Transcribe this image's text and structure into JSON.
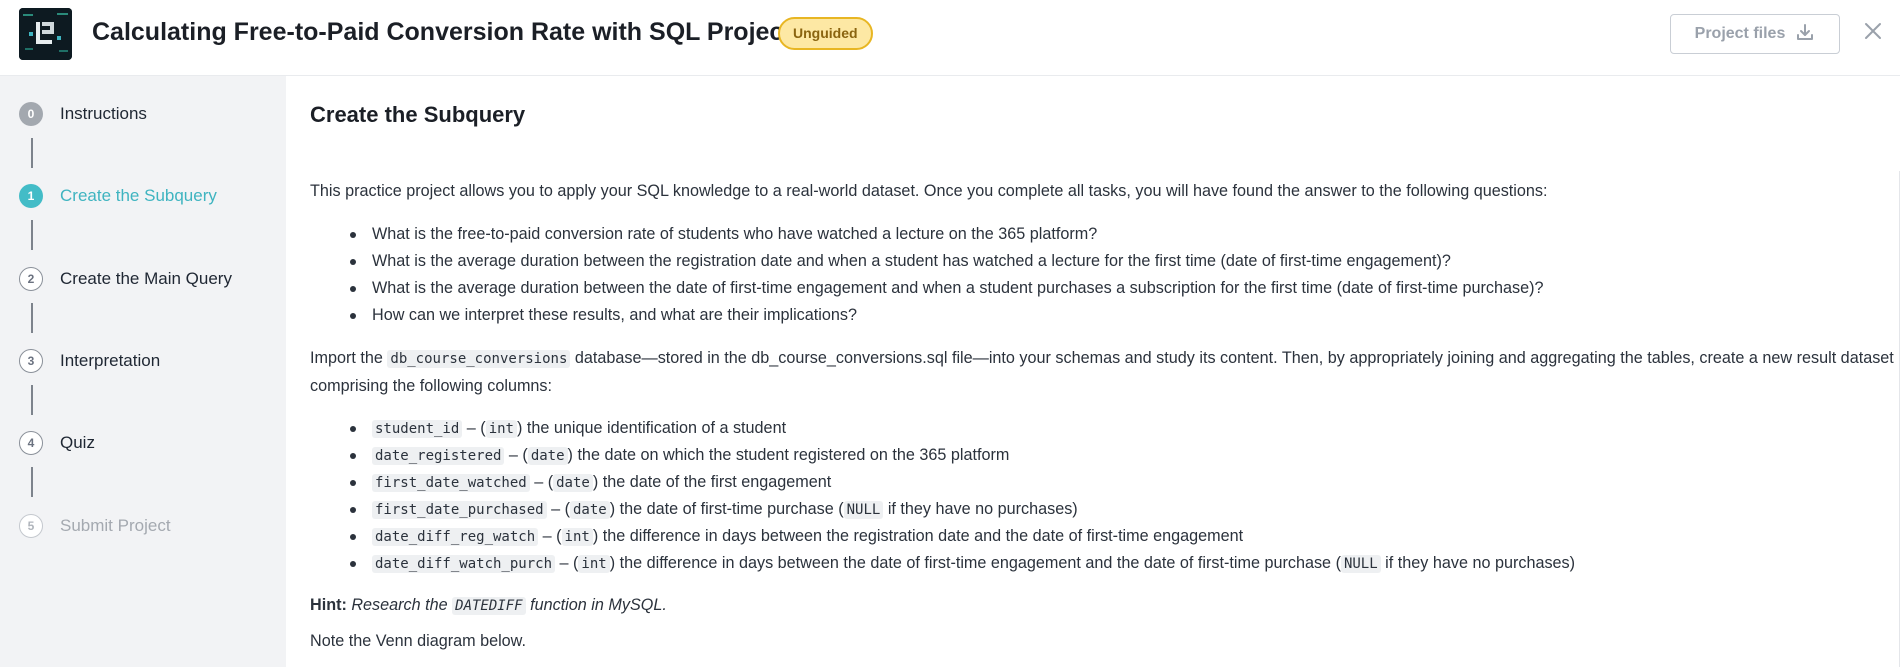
{
  "header": {
    "title": "Calculating Free-to-Paid Conversion Rate with SQL Project",
    "badge": "Unguided",
    "project_files_label": "Project files"
  },
  "sidebar": {
    "steps": [
      {
        "num": "0",
        "label": "Instructions",
        "state": "done"
      },
      {
        "num": "1",
        "label": "Create the Subquery",
        "state": "active"
      },
      {
        "num": "2",
        "label": "Create the Main Query",
        "state": "todo"
      },
      {
        "num": "3",
        "label": "Interpretation",
        "state": "todo"
      },
      {
        "num": "4",
        "label": "Quiz",
        "state": "todo"
      },
      {
        "num": "5",
        "label": "Submit Project",
        "state": "disabled"
      }
    ]
  },
  "main": {
    "section_title": "Create the Subquery",
    "intro": "This practice project allows you to apply your SQL knowledge to a real-world dataset. Once you complete all tasks, you will have found the answer to the following questions:",
    "questions": [
      "What is the free-to-paid conversion rate of students who have watched a lecture on the 365 platform?",
      "What is the average duration between the registration date and when a student has watched a lecture for the first time (date of first-time engagement)?",
      "What is the average duration between the date of first-time engagement and when a student purchases a subscription for the first time (date of first-time purchase)?",
      "How can we interpret these results, and what are their implications?"
    ],
    "import": {
      "prefix": "Import the",
      "db_code": "db_course_conversions",
      "text": "database—stored in the db_course_conversions.sql file—into your schemas and study its content. Then, by appropriately joining and aggregating the tables, create a new result dataset comprising the following columns:"
    },
    "columns": [
      {
        "name": "student_id",
        "type": "int",
        "desc": "the unique identification of a student",
        "null_note_pre": "",
        "null_code": "",
        "null_note_post": ""
      },
      {
        "name": "date_registered",
        "type": "date",
        "desc": "the date on which the student registered on the 365 platform",
        "null_note_pre": "",
        "null_code": "",
        "null_note_post": ""
      },
      {
        "name": "first_date_watched",
        "type": "date",
        "desc": "the date of the first engagement",
        "null_note_pre": "",
        "null_code": "",
        "null_note_post": ""
      },
      {
        "name": "first_date_purchased",
        "type": "date",
        "desc": "the date of first-time purchase",
        "null_note_pre": "(",
        "null_code": "NULL",
        "null_note_post": "if they have no purchases)"
      },
      {
        "name": "date_diff_reg_watch",
        "type": "int",
        "desc": "the difference in days between the registration date and the date of first-time engagement",
        "null_note_pre": "",
        "null_code": "",
        "null_note_post": ""
      },
      {
        "name": "date_diff_watch_purch",
        "type": "int",
        "desc": "the difference in days between the date of first-time engagement and the date of first-time purchase",
        "null_note_pre": "(",
        "null_code": "NULL",
        "null_note_post": "if they have no purchases)"
      }
    ],
    "hint": {
      "label": "Hint:",
      "pre": "Research the",
      "code": "DATEDIFF",
      "post": "function in MySQL."
    },
    "note": "Note the Venn diagram below."
  },
  "colors": {
    "accent": "#43bcc7",
    "badge_bg": "#fde8a4",
    "badge_border": "#e8b623",
    "sidebar_bg": "#f2f3f5"
  }
}
